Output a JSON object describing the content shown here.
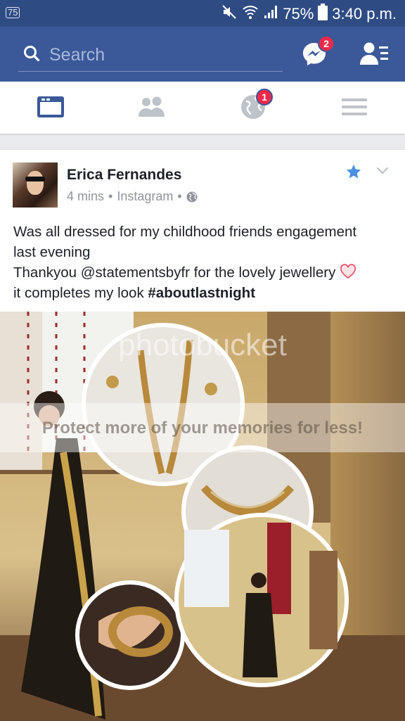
{
  "status_bar": {
    "carrier_label": "75",
    "battery": "75%",
    "time": "3:40 p.m.",
    "icons": [
      "mute-icon",
      "wifi-icon",
      "signal-icon",
      "battery-icon"
    ]
  },
  "topbar": {
    "search_placeholder": "Search",
    "messenger_badge": "2",
    "brand_color": "#3b5998"
  },
  "navbar": {
    "items": [
      "news-feed",
      "friend-requests",
      "notifications",
      "more-menu"
    ],
    "notifications_badge": "1",
    "active_color": "#3b5998"
  },
  "post": {
    "author": "Erica Fernandes",
    "time": "4 mins",
    "source": "Instagram",
    "text_line1": "Was all dressed for my childhood friends engagement",
    "text_line2": "last evening",
    "text_line3a": "Thankyou @statementsbyfr for the lovely jewellery",
    "text_line4a": "it completes my look ",
    "hashtag": "#aboutlastnight",
    "watermark": "photobucket",
    "watermark_banner": "Protect more of your memories for less!"
  }
}
